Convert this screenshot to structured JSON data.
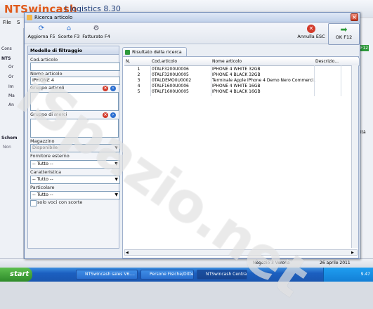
{
  "background_app": {
    "brand": "NTSwincash",
    "brand_suffix": "| logistics 8.30",
    "menu": [
      "File",
      "S"
    ],
    "left_items": [
      "Cons",
      "NTS",
      "Or",
      "Or",
      "Im",
      "Ma",
      "An",
      "Schem",
      "Non"
    ],
    "right_items": [
      "F12",
      "ità"
    ],
    "status_store": "Negozio 3 Verona",
    "status_date": "26 aprile 2011"
  },
  "taskbar": {
    "start": "start",
    "items": [
      "NTSwincash sales V6....",
      "Persone Fisiche/Ditte ...",
      "NTSwincash Central L..."
    ],
    "clock": "9.47"
  },
  "dialog": {
    "title": "Ricerca articolo",
    "toolbar": {
      "refresh": "Aggiorna F5",
      "stock": "Scorte F3",
      "invoiced": "Fatturato F4",
      "cancel": "Annulla ESC",
      "ok": "OK F12"
    },
    "filter": {
      "header": "Modello di filtraggio",
      "code_label": "Cod.articolo",
      "code_value": "",
      "name_label": "Nome articolo",
      "name_value": "IPHONE 4",
      "group_label": "Gruppo articoli",
      "goods_group_label": "Gruppo di merci",
      "warehouse_label": "Magazzino",
      "warehouse_value": "Disponibile",
      "supplier_label": "Fornitore esterno",
      "supplier_value": "-- Tutto --",
      "feature_label": "Caratteristica",
      "feature_value": "-- Tutto --",
      "particular_label": "Particolare",
      "particular_value": "-- Tutto --",
      "stock_only_label": "solo voci con scorte"
    },
    "results": {
      "tab": "Risultato della ricerca",
      "columns": [
        "N.",
        "Cod.articolo",
        "Nome articolo",
        "Descrizio..."
      ],
      "rows": [
        {
          "n": "1",
          "code": "0TALF3200U0006",
          "name": "IPHONE 4 WHITE 32GB",
          "desc": ""
        },
        {
          "n": "2",
          "code": "0TALF3200U0005",
          "name": "IPHONE 4 BLACK 32GB",
          "desc": ""
        },
        {
          "n": "3",
          "code": "0TALDEMO0U0002",
          "name": "Terminale Apple iPhone 4 Demo Nero Commerci...",
          "desc": ""
        },
        {
          "n": "4",
          "code": "0TALF1600U0006",
          "name": "IPHONE 4 WHITE 16GB",
          "desc": ""
        },
        {
          "n": "5",
          "code": "0TALF1600U0005",
          "name": "IPHONE 4 BLACK 16GB",
          "desc": ""
        }
      ]
    }
  },
  "watermark": "iSpazio.net"
}
